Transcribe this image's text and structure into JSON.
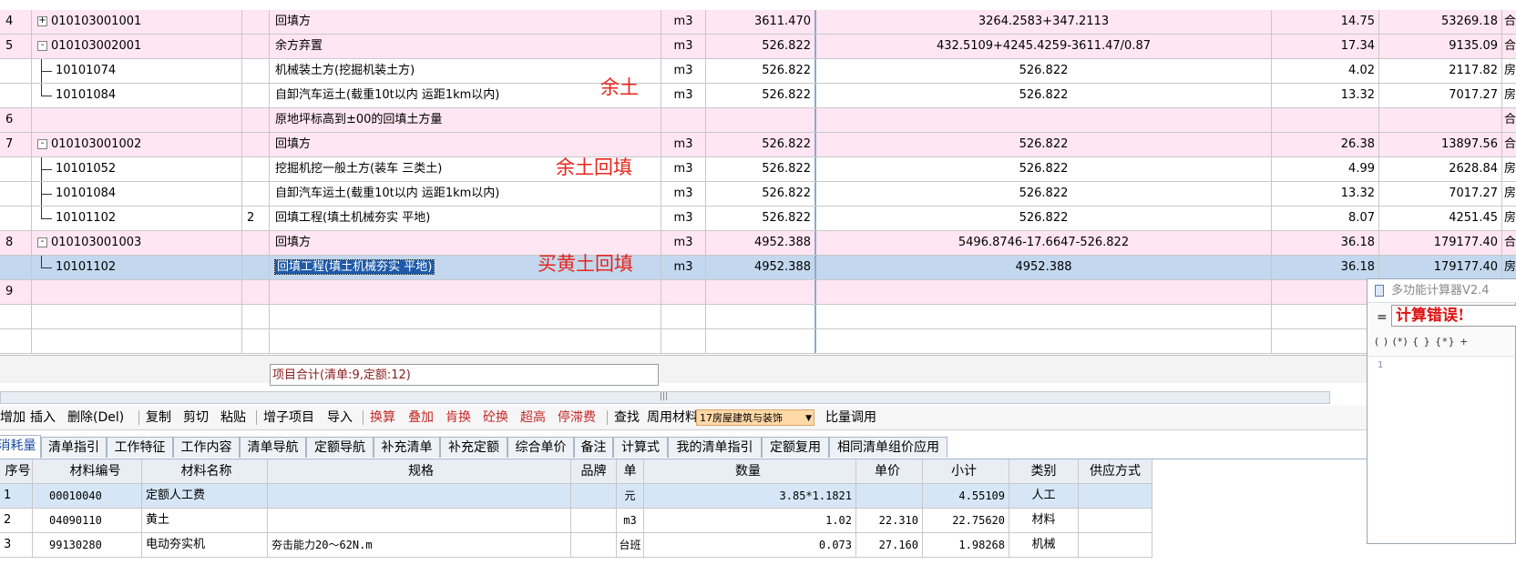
{
  "main_rows": [
    {
      "idx": "4",
      "code": "010103001001",
      "num": "",
      "name": "回填方",
      "unit": "m3",
      "qty": "3611.470",
      "expr": "3264.2583+347.2113",
      "price": "14.75",
      "total": "53269.18",
      "type": "合",
      "style": "pink",
      "expand": "+"
    },
    {
      "idx": "5",
      "code": "010103002001",
      "num": "",
      "name": "余方弃置",
      "unit": "m3",
      "qty": "526.822",
      "expr": "432.5109+4245.4259-3611.47/0.87",
      "price": "17.34",
      "total": "9135.09",
      "type": "合",
      "style": "pink",
      "expand": "-"
    },
    {
      "idx": "",
      "code": "10101074",
      "num": "",
      "name": "机械装土方(挖掘机装土方)",
      "unit": "m3",
      "qty": "526.822",
      "expr": "526.822",
      "price": "4.02",
      "total": "2117.82",
      "type": "房",
      "style": "white",
      "tree": "mid"
    },
    {
      "idx": "",
      "code": "10101084",
      "num": "",
      "name": "自卸汽车运土(载重10t以内 运距1km以内)",
      "unit": "m3",
      "qty": "526.822",
      "expr": "526.822",
      "price": "13.32",
      "total": "7017.27",
      "type": "房",
      "style": "white",
      "tree": "end"
    },
    {
      "idx": "6",
      "code": "",
      "num": "",
      "name": "原地坪标高到±00的回填土方量",
      "unit": "",
      "qty": "",
      "expr": "",
      "price": "",
      "total": "",
      "type": "合",
      "style": "pink"
    },
    {
      "idx": "7",
      "code": "010103001002",
      "num": "",
      "name": "回填方",
      "unit": "m3",
      "qty": "526.822",
      "expr": "526.822",
      "price": "26.38",
      "total": "13897.56",
      "type": "合",
      "style": "pink",
      "expand": "-"
    },
    {
      "idx": "",
      "code": "10101052",
      "num": "",
      "name": "挖掘机挖一般土方(装车 三类土)",
      "unit": "m3",
      "qty": "526.822",
      "expr": "526.822",
      "price": "4.99",
      "total": "2628.84",
      "type": "房",
      "style": "white",
      "tree": "mid"
    },
    {
      "idx": "",
      "code": "10101084",
      "num": "",
      "name": "自卸汽车运土(载重10t以内 运距1km以内)",
      "unit": "m3",
      "qty": "526.822",
      "expr": "526.822",
      "price": "13.32",
      "total": "7017.27",
      "type": "房",
      "style": "white",
      "tree": "mid"
    },
    {
      "idx": "",
      "code": "10101102",
      "num": "2",
      "name": "回填工程(填土机械夯实 平地)",
      "unit": "m3",
      "qty": "526.822",
      "expr": "526.822",
      "price": "8.07",
      "total": "4251.45",
      "type": "房",
      "style": "white",
      "tree": "end"
    },
    {
      "idx": "8",
      "code": "010103001003",
      "num": "",
      "name": "回填方",
      "unit": "m3",
      "qty": "4952.388",
      "expr": "5496.8746-17.6647-526.822",
      "price": "36.18",
      "total": "179177.40",
      "type": "合",
      "style": "pink",
      "expand": "-"
    },
    {
      "idx": "",
      "code": "10101102",
      "num": "",
      "name": "回填工程(填土机械夯实 平地)",
      "unit": "m3",
      "qty": "4952.388",
      "expr": "4952.388",
      "price": "36.18",
      "total": "179177.40",
      "type": "房",
      "style": "selected",
      "tree": "end"
    },
    {
      "idx": "9",
      "code": "",
      "num": "",
      "name": "",
      "unit": "",
      "qty": "",
      "expr": "",
      "price": "",
      "total": "",
      "type": "",
      "style": "pink"
    },
    {
      "idx": "",
      "code": "",
      "num": "",
      "name": "",
      "unit": "",
      "qty": "",
      "expr": "",
      "price": "",
      "total": "",
      "type": "",
      "style": "white"
    },
    {
      "idx": "",
      "code": "",
      "num": "",
      "name": "",
      "unit": "",
      "qty": "",
      "expr": "",
      "price": "",
      "total": "",
      "type": "",
      "style": "white"
    }
  ],
  "annotations": {
    "a1": "余土",
    "a2": "余土回填",
    "a3": "买黄土回填"
  },
  "project_total": "项目合计(清单:9,定额:12)",
  "toolbar": {
    "add": "增加",
    "insert": "插入",
    "delete": "删除(Del)",
    "copy": "复制",
    "cut": "剪切",
    "paste": "粘贴",
    "sub_item": "增子项目",
    "import": "导入",
    "convert": "换算",
    "overlay": "叠加",
    "ken_swap": "肯换",
    "concrete_swap": "砼换",
    "over_height": "超高",
    "stop_fee": "停滞费",
    "find": "查找",
    "common_material": "周用材料",
    "select_value": "17房屋建筑与装饰",
    "ratio_adjust": "比量调用"
  },
  "tabs": [
    "消耗量",
    "清单指引",
    "工作特征",
    "工作内容",
    "清单导航",
    "定额导航",
    "补充清单",
    "补充定额",
    "综合单价",
    "备注",
    "计算式",
    "我的清单指引",
    "定额复用",
    "相同清单组价应用"
  ],
  "sub_headers": [
    "序号",
    "材料编号",
    "材料名称",
    "规格",
    "品牌",
    "单",
    "数量",
    "单价",
    "小计",
    "类别",
    "供应方式"
  ],
  "sub_rows": [
    {
      "no": "1",
      "code": "00010040",
      "name": "定额人工费",
      "spec": "",
      "brand": "",
      "unit": "元",
      "qty": "3.85*1.1821",
      "price": "",
      "subtotal": "4.55109",
      "cat": "人工",
      "supply": ""
    },
    {
      "no": "2",
      "code": "04090110",
      "name": "黄土",
      "spec": "",
      "brand": "",
      "unit": "m3",
      "qty": "1.02",
      "price": "22.310",
      "subtotal": "22.75620",
      "cat": "材料",
      "supply": ""
    },
    {
      "no": "3",
      "code": "99130280",
      "name": "电动夯实机",
      "spec": "夯击能力20～62N.m",
      "brand": "",
      "unit": "台班",
      "qty": "0.073",
      "price": "27.160",
      "subtotal": "1.98268",
      "cat": "机械",
      "supply": ""
    }
  ],
  "calculator": {
    "title": "多功能计算器V2.4",
    "eq": "=",
    "result": "计算错误!",
    "ops": "( ) (*) { } {*} +",
    "line": "1"
  }
}
